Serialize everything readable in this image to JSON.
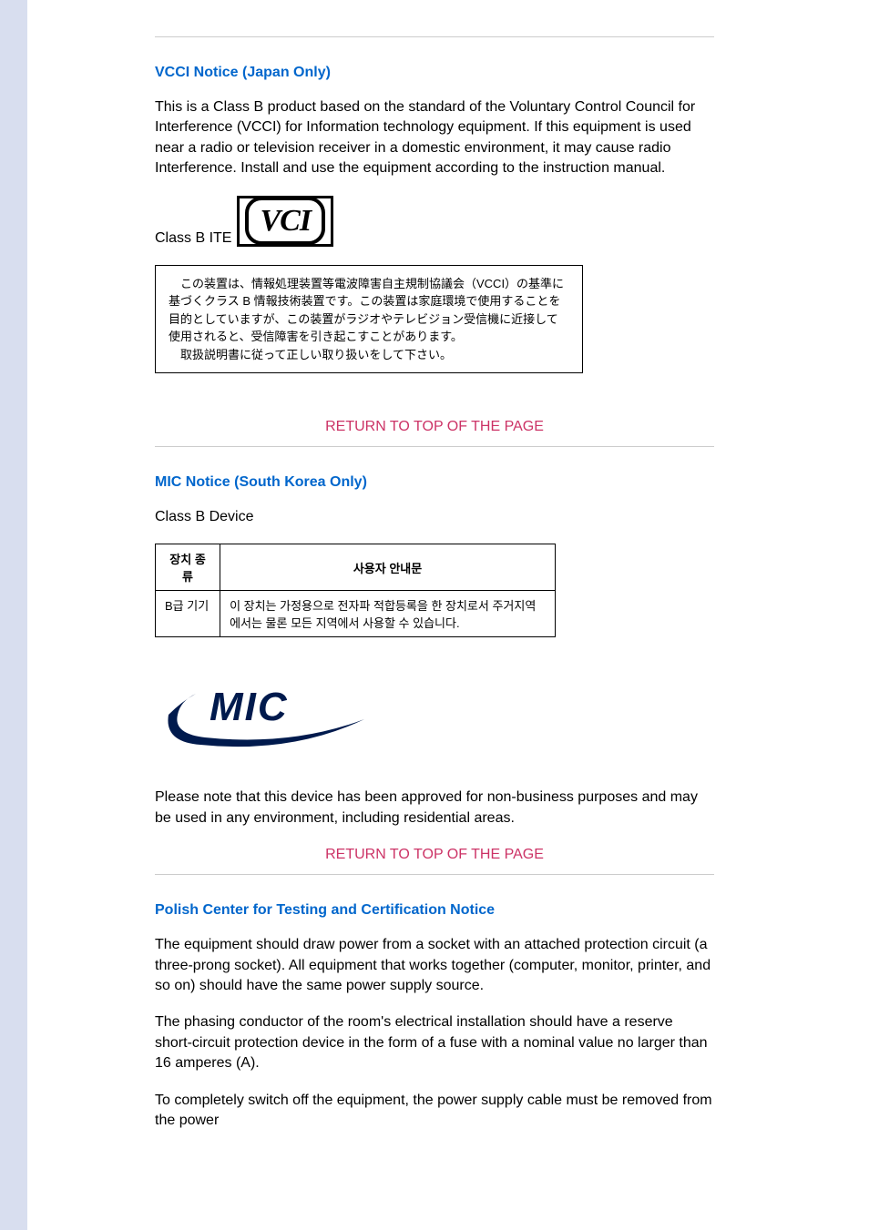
{
  "vcci": {
    "heading": "VCCI Notice (Japan Only)",
    "body": "This is a Class B product based on the standard of the Voluntary Control Council for Interference (VCCI) for Information technology equipment. If this equipment is used near a radio or television receiver in a domestic environment, it may cause radio Interference. Install and use the equipment according to the instruction manual.",
    "classb_label": "Class B ITE",
    "logo_text": "VCI",
    "jp_notice": "　この装置は、情報処理装置等電波障害自主規制協議会（VCCI）の基準に基づくクラス B 情報技術装置です。この装置は家庭環境で使用することを目的としていますが、この装置がラジオやテレビジョン受信機に近接して使用されると、受信障害を引き起こすことがあります。\n　取扱説明書に従って正しい取り扱いをして下さい。"
  },
  "mic": {
    "heading": "MIC Notice (South Korea Only)",
    "subhead": "Class B Device",
    "table": {
      "col1": "장치 종류",
      "col2": "사용자 안내문",
      "row1_c1": "B급 기기",
      "row1_c2": "이 장치는 가정용으로 전자파 적합등록을 한 장치로서 주거지역에서는 물론 모든 지역에서 사용할 수 있습니다."
    },
    "logo_text": "MIC",
    "body": "Please note that this device has been approved for non-business purposes and may be used in any environment, including residential areas."
  },
  "polish": {
    "heading": "Polish Center for Testing and Certification Notice",
    "p1": "The equipment should draw power from a socket with an attached protection circuit (a three-prong socket). All equipment that works together (computer, monitor, printer, and so on) should have the same power supply source.",
    "p2": "The phasing conductor of the room's electrical installation should have a reserve short-circuit protection device in the form of a fuse with a nominal value no larger than 16 amperes (A).",
    "p3": "To completely switch off the equipment, the power supply cable must be removed from the power"
  },
  "return_link": "RETURN TO TOP OF THE PAGE"
}
